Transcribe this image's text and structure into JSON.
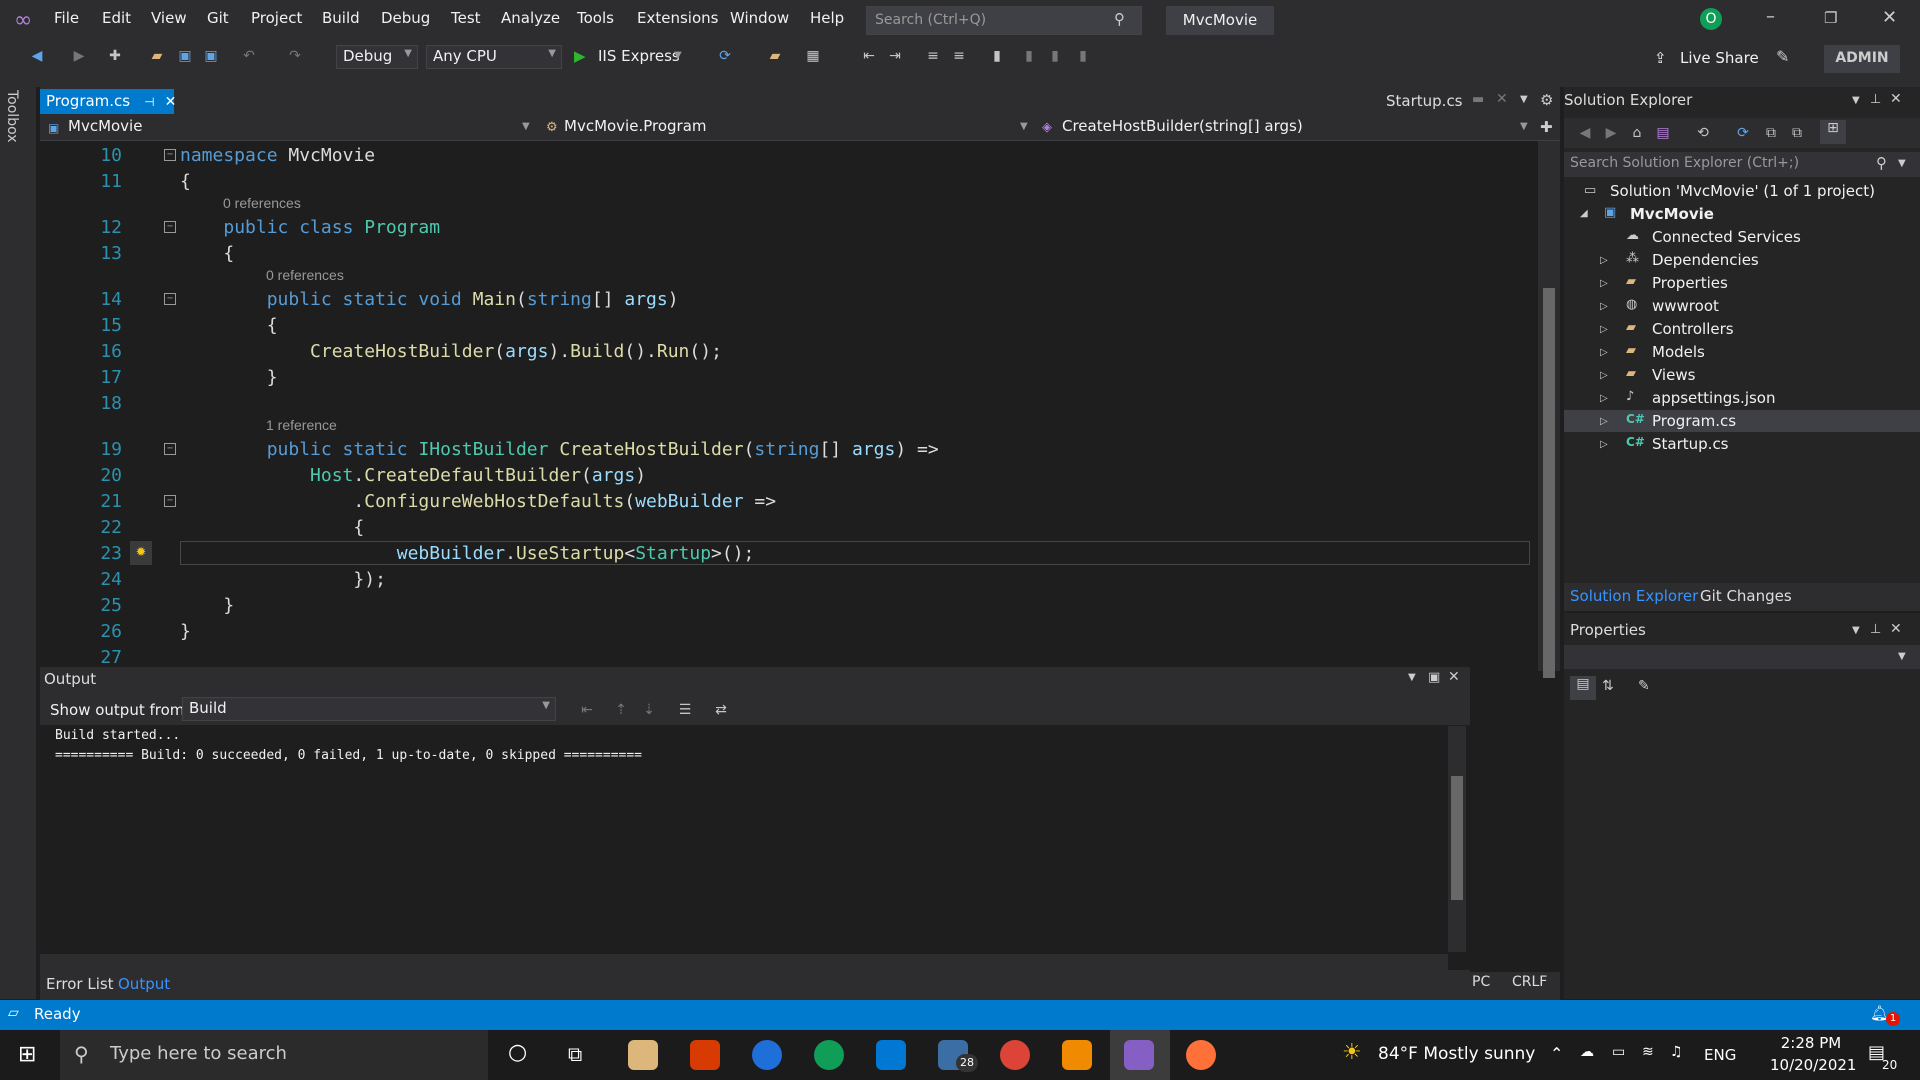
{
  "title_bar": {
    "menu": [
      "File",
      "Edit",
      "View",
      "Git",
      "Project",
      "Build",
      "Debug",
      "Test",
      "Analyze",
      "Tools",
      "Extensions",
      "Window",
      "Help"
    ],
    "search_placeholder": "Search (Ctrl+Q)",
    "solution_name": "MvcMovie",
    "account_initial": "O"
  },
  "toolbar": {
    "config": "Debug",
    "platform": "Any CPU",
    "run_target": "IIS Express",
    "live_share": "Live Share",
    "admin": "ADMIN"
  },
  "toolbox": {
    "label": "Toolbox"
  },
  "tabs": {
    "active": "Program.cs",
    "other": "Startup.cs"
  },
  "nav": {
    "project": "MvcMovie",
    "class": "MvcMovie.Program",
    "member": "CreateHostBuilder(string[] args)"
  },
  "editor": {
    "refs": {
      "r0a": "0 references",
      "r0b": "0 references",
      "r1": "1 reference"
    },
    "lines": [
      "10",
      "11",
      "12",
      "13",
      "14",
      "15",
      "16",
      "17",
      "18",
      "19",
      "20",
      "21",
      "22",
      "23",
      "24",
      "25",
      "26",
      "27"
    ]
  },
  "output": {
    "title": "Output",
    "show_from_label": "Show output from:",
    "source": "Build",
    "line1": "Build started...",
    "line2": "========== Build: 0 succeeded, 0 failed, 1 up-to-date, 0 skipped =========="
  },
  "bottom_tabs": {
    "error_list": "Error List",
    "output": "Output"
  },
  "editor_status": {
    "pc": "PC",
    "crlf": "CRLF"
  },
  "solution_explorer": {
    "title": "Solution Explorer",
    "search_placeholder": "Search Solution Explorer (Ctrl+;)",
    "solution": "Solution 'MvcMovie' (1 of 1 project)",
    "project": "MvcMovie",
    "items": [
      "Connected Services",
      "Dependencies",
      "Properties",
      "wwwroot",
      "Controllers",
      "Models",
      "Views",
      "appsettings.json",
      "Program.cs",
      "Startup.cs"
    ],
    "tab_solution": "Solution Explorer",
    "tab_git": "Git Changes"
  },
  "properties": {
    "title": "Properties"
  },
  "status": {
    "ready": "Ready"
  },
  "taskbar": {
    "search_placeholder": "Type here to search",
    "mail_badge": "28",
    "weather": "84°F  Mostly sunny",
    "lang": "ENG",
    "time": "2:28 PM",
    "date": "10/20/2021",
    "notif": "20"
  },
  "colors": {
    "accent": "#007acc",
    "keyword": "#569cd6",
    "type": "#4ec9b0",
    "method": "#dcdcaa",
    "param": "#9cdcfe"
  }
}
